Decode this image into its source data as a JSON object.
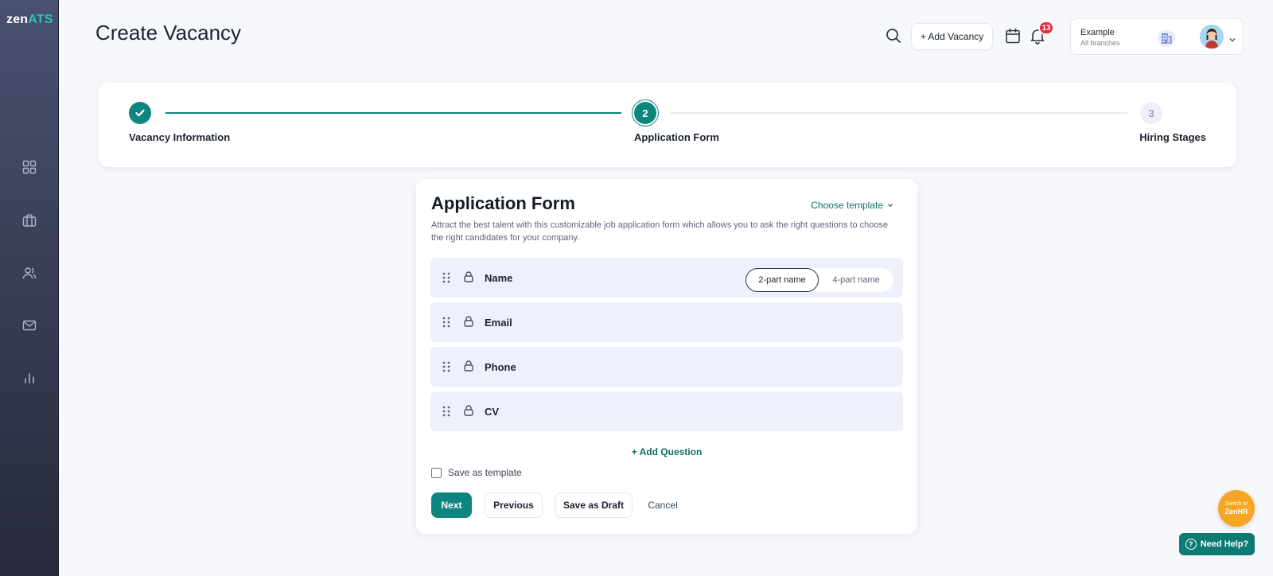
{
  "brand": {
    "logo_main": "zen",
    "logo_accent": "ATS"
  },
  "sidebar": {
    "items": [
      {
        "icon": "dashboard-icon"
      },
      {
        "icon": "briefcase-icon"
      },
      {
        "icon": "users-icon"
      },
      {
        "icon": "mail-icon"
      },
      {
        "icon": "analytics-icon"
      }
    ]
  },
  "header": {
    "title": "Create Vacancy",
    "add_vacancy_label": "+ Add Vacancy",
    "notifications_count": "13",
    "company_name": "Example",
    "company_scope": "All branches"
  },
  "stepper": {
    "steps": [
      {
        "label": "Vacancy Information",
        "status": "complete",
        "number": "1"
      },
      {
        "label": "Application Form",
        "status": "active",
        "number": "2"
      },
      {
        "label": "Hiring Stages",
        "status": "pending",
        "number": "3"
      }
    ]
  },
  "form": {
    "title": "Application Form",
    "choose_template_label": "Choose template",
    "description": "Attract the best talent with this customizable job application form which allows you to ask the right questions to choose the right candidates for your company.",
    "fields": [
      {
        "label": "Name",
        "locked": true
      },
      {
        "label": "Email",
        "locked": true
      },
      {
        "label": "Phone",
        "locked": true
      },
      {
        "label": "CV",
        "locked": true
      }
    ],
    "name_options": {
      "selected": "2-part name",
      "other": "4-part name"
    },
    "add_question_label": "+ Add Question",
    "save_template_label": "Save as template",
    "buttons": {
      "next": "Next",
      "previous": "Previous",
      "draft": "Save as Draft",
      "cancel": "Cancel"
    }
  },
  "widgets": {
    "switch_small": "Switch to",
    "switch_big": "ZenHR",
    "need_help": "Need Help?"
  },
  "colors": {
    "primary": "#0e8680",
    "badge": "#e5283c",
    "switch": "#f5a623",
    "field_bg": "#eef1fb"
  }
}
